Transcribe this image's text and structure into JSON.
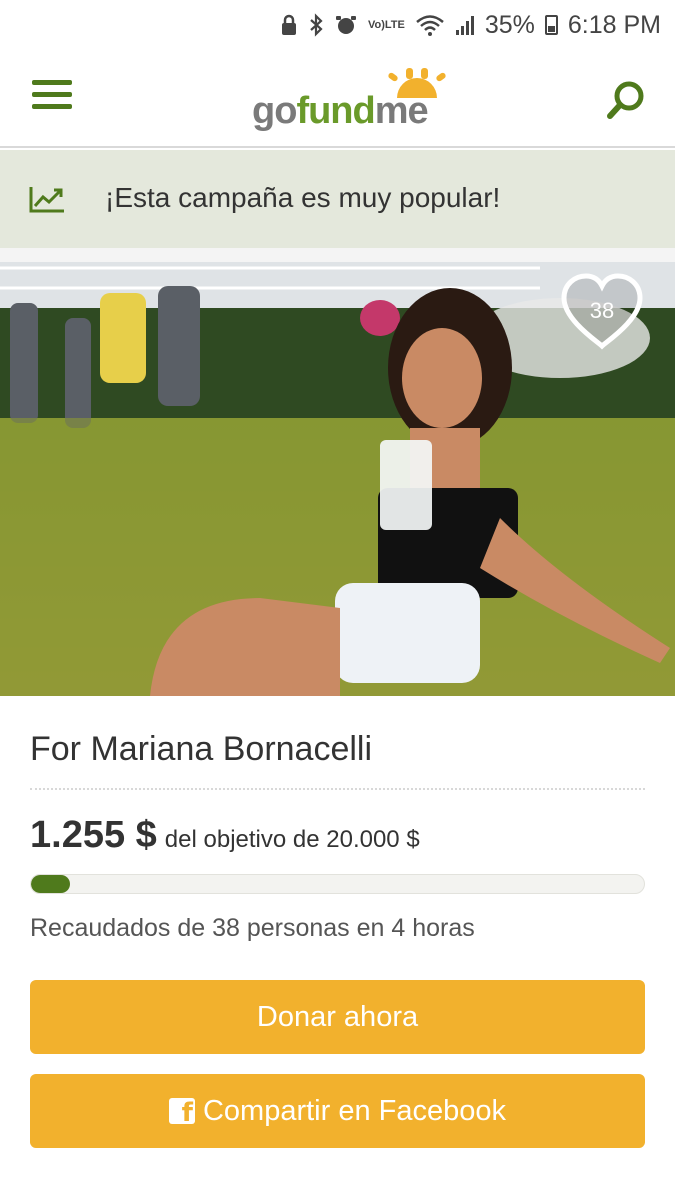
{
  "status_bar": {
    "battery": "35%",
    "time": "6:18 PM",
    "lte_line1": "Vo)",
    "lte_line2": "LTE"
  },
  "header": {
    "logo_part1": "go",
    "logo_part2": "fund",
    "logo_part3": "me",
    "menu_icon": "hamburger-icon",
    "search_icon": "search-icon"
  },
  "banner": {
    "text": "¡Esta campaña es muy popular!",
    "icon": "trend-up-icon"
  },
  "photo": {
    "heart_count": "38",
    "heart_icon": "heart-icon"
  },
  "campaign": {
    "title": "For Mariana Bornacelli",
    "amount": "1.255 $",
    "goal_text": "del objetivo de 20.000 $",
    "progress_fraction": 0.063,
    "raised_text": "Recaudados de 38 personas en 4 horas"
  },
  "actions": {
    "donate_label": "Donar ahora",
    "share_label": "Compartir en Facebook",
    "fb_icon_glyph": "f"
  },
  "colors": {
    "brand_green": "#4f7a1c",
    "button_orange": "#f2b12d",
    "banner_bg": "#e4e8dc"
  }
}
